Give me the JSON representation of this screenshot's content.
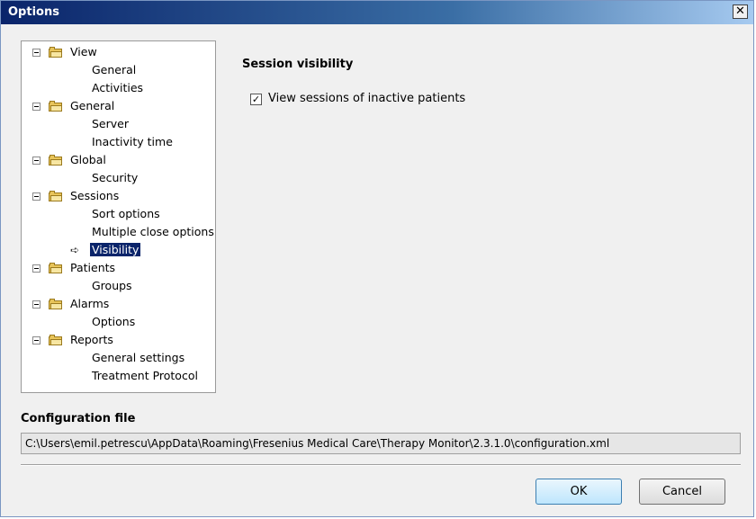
{
  "window": {
    "title": "Options",
    "close_glyph": "✕"
  },
  "tree": {
    "groups": [
      {
        "label": "View",
        "children": [
          "General",
          "Activities"
        ]
      },
      {
        "label": "General",
        "children": [
          "Server",
          "Inactivity time"
        ]
      },
      {
        "label": "Global",
        "children": [
          "Security"
        ]
      },
      {
        "label": "Sessions",
        "children": [
          "Sort options",
          "Multiple close options",
          "Visibility"
        ]
      },
      {
        "label": "Patients",
        "children": [
          "Groups"
        ]
      },
      {
        "label": "Alarms",
        "children": [
          "Options"
        ]
      },
      {
        "label": "Reports",
        "children": [
          "General settings",
          "Treatment Protocol"
        ]
      }
    ],
    "selected_item": "Visibility",
    "selected_marker": "➪"
  },
  "panel": {
    "section_title": "Session visibility",
    "checkbox": {
      "label": "View sessions of inactive patients",
      "checked": true,
      "check_glyph": "✓"
    }
  },
  "config": {
    "title": "Configuration file",
    "path": "C:\\Users\\emil.petrescu\\AppData\\Roaming\\Fresenius Medical Care\\Therapy Monitor\\2.3.1.0\\configuration.xml"
  },
  "buttons": {
    "ok": "OK",
    "cancel": "Cancel"
  }
}
